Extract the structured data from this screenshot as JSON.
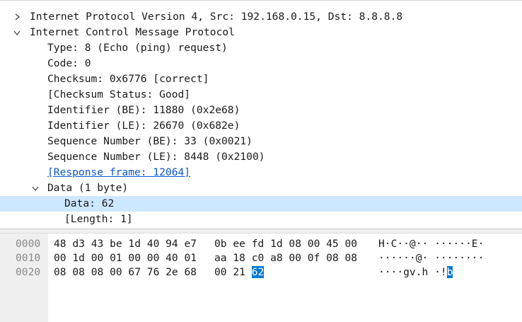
{
  "tree": {
    "rows": [
      {
        "id": "ipv4",
        "text": "Internet Protocol Version 4, Src: 192.168.0.15, Dst: 8.8.8.8",
        "expanded": false
      },
      {
        "id": "icmp",
        "text": "Internet Control Message Protocol",
        "expanded": true
      },
      {
        "id": "type",
        "text": "Type: 8 (Echo (ping) request)"
      },
      {
        "id": "code",
        "text": "Code: 0"
      },
      {
        "id": "checksum",
        "text": "Checksum: 0x6776 [correct]"
      },
      {
        "id": "checksum-status",
        "text": "[Checksum Status: Good]"
      },
      {
        "id": "identifier-be",
        "text": "Identifier (BE): 11880 (0x2e68)"
      },
      {
        "id": "identifier-le",
        "text": "Identifier (LE): 26670 (0x682e)"
      },
      {
        "id": "seq-be",
        "text": "Sequence Number (BE): 33 (0x0021)"
      },
      {
        "id": "seq-le",
        "text": "Sequence Number (LE): 8448 (0x2100)"
      },
      {
        "id": "response-frame",
        "text": "[Response frame: 12064]"
      },
      {
        "id": "data",
        "text": "Data (1 byte)",
        "expanded": true
      },
      {
        "id": "data-value",
        "text": "Data: 62",
        "selected": true
      },
      {
        "id": "length",
        "text": "[Length: 1]"
      }
    ]
  },
  "hex": {
    "rows": [
      {
        "offset": "0000",
        "bytes_a": "48 d3 43 be 1d 40 94 e7",
        "bytes_b": "0b ee fd 1d 08 00 45 00",
        "ascii": "H·C··@·· ······E·"
      },
      {
        "offset": "0010",
        "bytes_a": "00 1d 00 01 00 00 40 01",
        "bytes_b": "aa 18 c0 a8 00 0f 08 08",
        "ascii": "······@· ········"
      },
      {
        "offset": "0020",
        "bytes_a": "08 08 08 00 67 76 2e 68",
        "bytes_b_plain": "00 21 ",
        "bytes_b_highlight": "62",
        "ascii_plain": "····gv.h ·!",
        "ascii_highlight": "b"
      }
    ]
  },
  "colors": {
    "selection": "#cce8ff",
    "byte_highlight": "#0078d7",
    "link": "#0b57d0",
    "offset_gutter": "#efefef"
  }
}
